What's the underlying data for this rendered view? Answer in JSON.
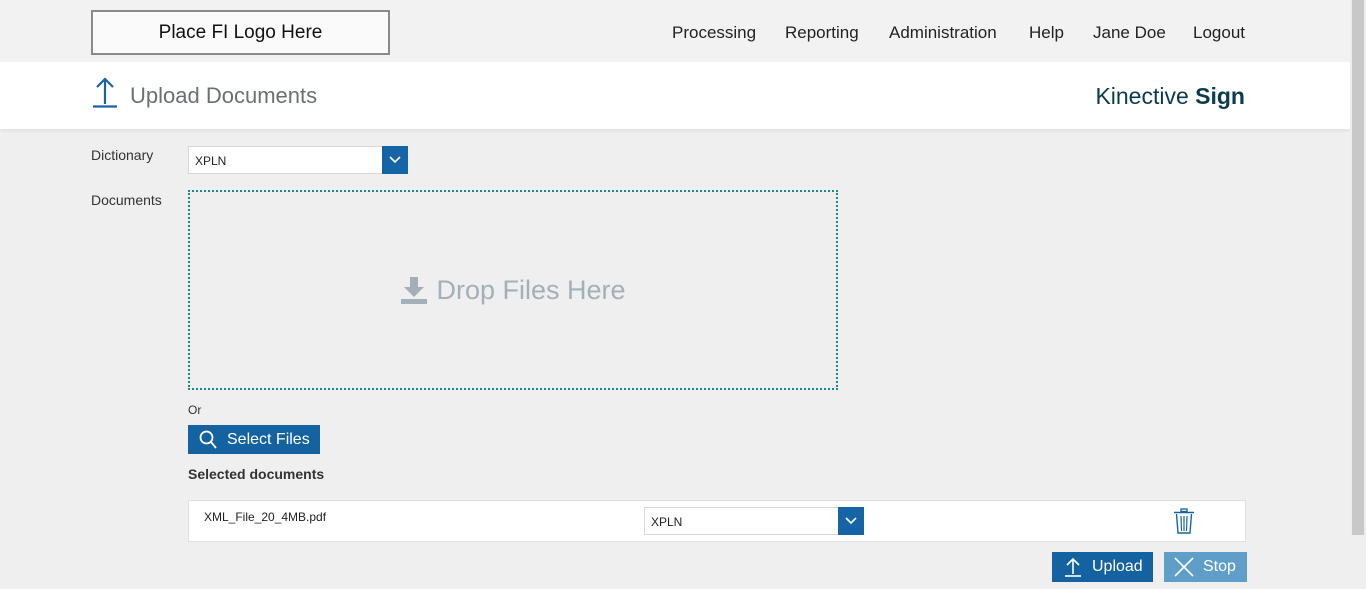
{
  "top_nav": {
    "logo_text": "Place FI Logo Here",
    "items": [
      "Processing",
      "Reporting",
      "Administration",
      "Help",
      "Jane Doe",
      "Logout"
    ]
  },
  "header": {
    "title": "Upload Documents",
    "brand_light": "Kinective",
    "brand_bold": "Sign",
    "icon": "upload-arrow-icon"
  },
  "form": {
    "dictionary_label": "Dictionary",
    "dictionary_value": "XPLN",
    "documents_label": "Documents",
    "drop_text": "Drop Files Here",
    "or_text": "Or",
    "select_files_label": "Select Files",
    "selected_documents_label": "Selected documents"
  },
  "selected_documents": [
    {
      "file_name": "XML_File_20_4MB.pdf",
      "dictionary": "XPLN"
    }
  ],
  "actions": {
    "upload_label": "Upload",
    "stop_label": "Stop"
  },
  "colors": {
    "accent": "#1462a0",
    "stop_button": "#5f9ec9",
    "dropzone_border": "#1f8a8d",
    "brand_text": "#0b3c4d"
  }
}
